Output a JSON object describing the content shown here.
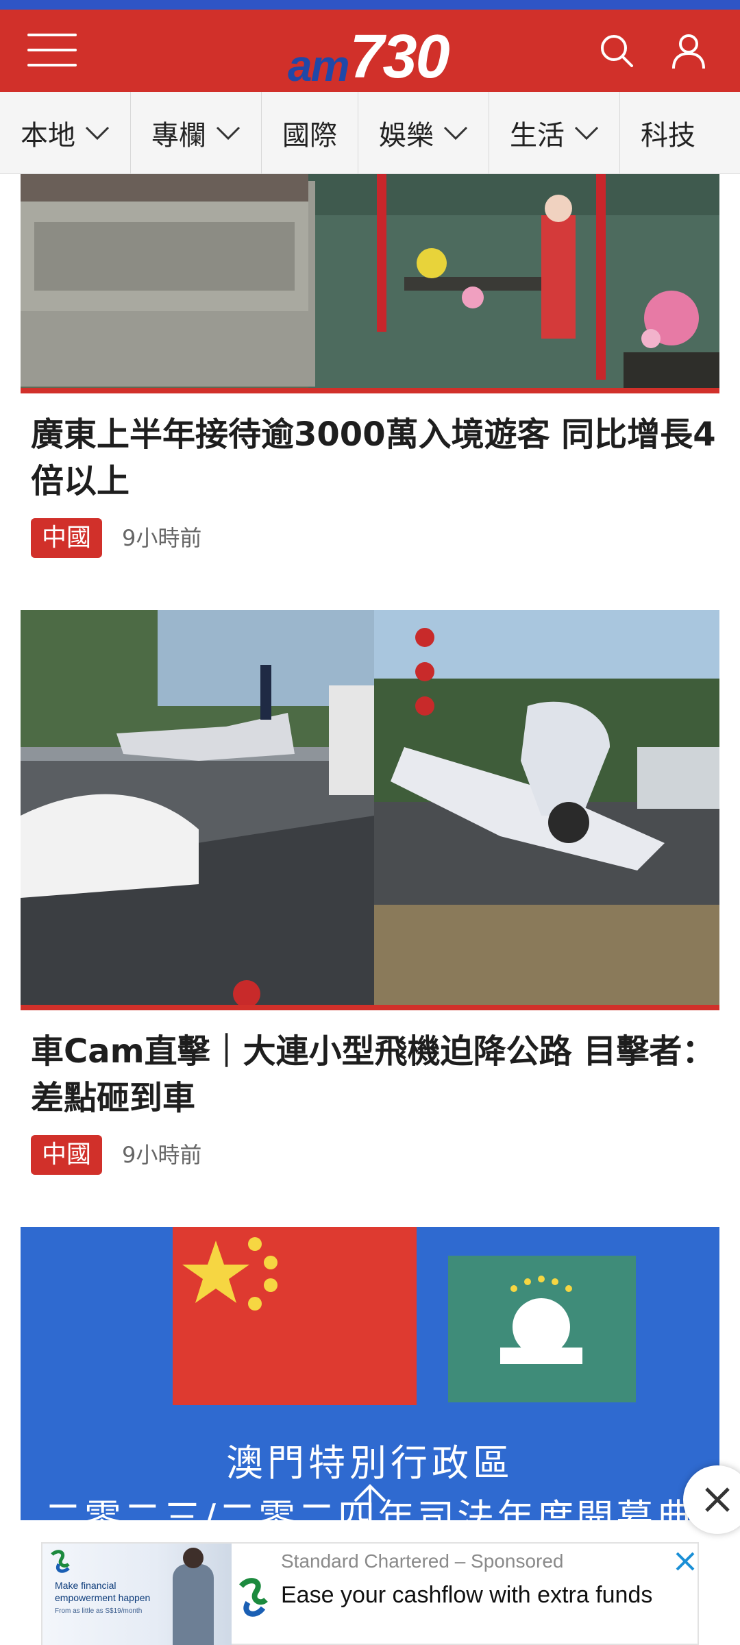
{
  "header": {
    "logo_am": "am",
    "logo_num": "730",
    "menu_icon": "hamburger-menu-icon",
    "search_icon": "search-icon",
    "user_icon": "user-icon",
    "brand_color": "#d1302a",
    "logo_blue": "#2048a8"
  },
  "nav": {
    "items": [
      {
        "label": "本地",
        "has_dropdown": true
      },
      {
        "label": "專欄",
        "has_dropdown": true
      },
      {
        "label": "國際",
        "has_dropdown": false
      },
      {
        "label": "娛樂",
        "has_dropdown": true
      },
      {
        "label": "生活",
        "has_dropdown": true
      },
      {
        "label": "科技",
        "has_dropdown": false
      }
    ]
  },
  "articles": [
    {
      "title": "廣東上半年接待逾3000萬入境遊客 同比增長4倍以上",
      "tag": "中國",
      "time": "9小時前"
    },
    {
      "title": "車Cam直擊｜大連小型飛機迫降公路 目擊者：差點砸到車",
      "tag": "中國",
      "time": "9小時前"
    },
    {
      "image_caption_line1": "澳門特別行政區",
      "image_caption_line2": "二零二三/二零二四年司法年度開幕典"
    }
  ],
  "ad": {
    "brand": "Standard Chartered",
    "sponsored": "Sponsored",
    "sponsor_line": "Standard Chartered – Sponsored",
    "headline": "Ease your cashflow with extra funds",
    "thumb_text": "Make financial empowerment happen",
    "thumb_small": "From as little as S$19/month",
    "thumb_brand": "Standard Chartered"
  },
  "floating": {
    "close_icon": "close-icon",
    "scroll_top_icon": "arrow-up-icon"
  }
}
